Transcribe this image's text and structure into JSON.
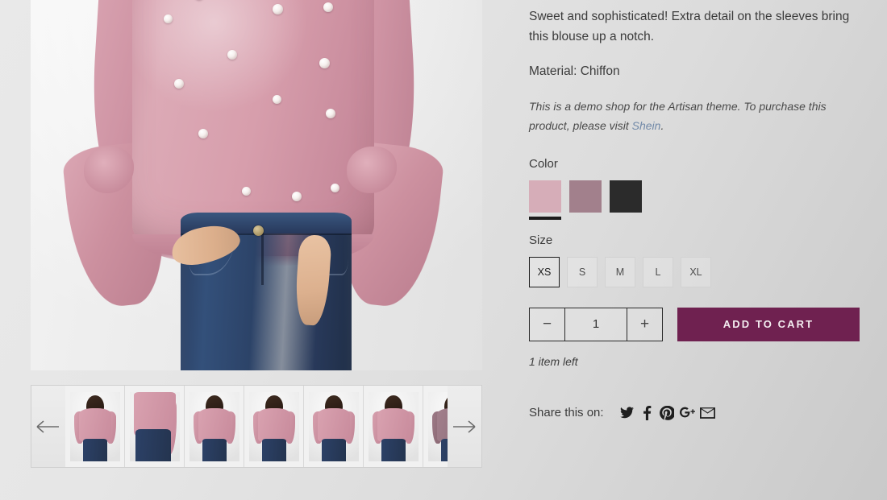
{
  "product": {
    "description_1": "Sweet and sophisticated! Extra detail on the sleeves bring this blouse up a notch.",
    "description_2": "Material: Chiffon",
    "demo_note_prefix": "This is a demo shop for the Artisan theme. To purchase this product, please visit ",
    "demo_note_link": "Shein",
    "demo_note_suffix": ".",
    "stock_text": "1 item left"
  },
  "options": {
    "color_label": "Color",
    "colors": [
      {
        "name": "pink",
        "hex": "#d6adb8",
        "selected": true
      },
      {
        "name": "mauve",
        "hex": "#a2808c",
        "selected": false
      },
      {
        "name": "charcoal",
        "hex": "#2b2b2b",
        "selected": false
      }
    ],
    "size_label": "Size",
    "sizes": [
      {
        "label": "XS",
        "selected": true
      },
      {
        "label": "S",
        "selected": false
      },
      {
        "label": "M",
        "selected": false
      },
      {
        "label": "L",
        "selected": false
      },
      {
        "label": "XL",
        "selected": false
      }
    ]
  },
  "purchase": {
    "quantity": "1",
    "decrease_label": "−",
    "increase_label": "+",
    "add_to_cart_label": "ADD TO CART",
    "accent_color": "#6f2150"
  },
  "share": {
    "label": "Share this on:",
    "icons": [
      {
        "name": "twitter-icon"
      },
      {
        "name": "facebook-icon"
      },
      {
        "name": "pinterest-icon"
      },
      {
        "name": "googleplus-icon"
      },
      {
        "name": "email-icon"
      }
    ]
  },
  "gallery": {
    "prev_label": "←",
    "next_label": "→",
    "thumbnails": [
      {
        "index": 1,
        "variant": "front",
        "active": true
      },
      {
        "index": 2,
        "variant": "crop",
        "active": false
      },
      {
        "index": 3,
        "variant": "side",
        "active": false
      },
      {
        "index": 4,
        "variant": "front",
        "active": false
      },
      {
        "index": 5,
        "variant": "angle",
        "active": false
      },
      {
        "index": 6,
        "variant": "front",
        "active": false
      },
      {
        "index": 7,
        "variant": "alt",
        "active": false
      }
    ]
  }
}
